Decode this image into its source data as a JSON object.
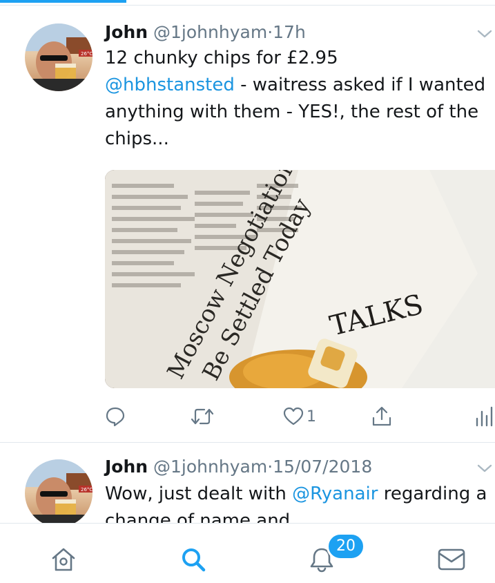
{
  "tweets": [
    {
      "name": "John",
      "handle": "@1johnhyam",
      "separator": "·",
      "time": "17h",
      "text_parts": {
        "line1": "12 chunky chips for £2.95",
        "mention": "@hbhstansted",
        "rest": " - waitress asked if I wanted anything with them - YES!, the rest of the chips..."
      },
      "media": {
        "headline_1": "Moscow Negotiation",
        "headline_2": "Be Settled Today",
        "headline_3": "TALKS"
      },
      "actions": {
        "like_count": "1"
      }
    },
    {
      "name": "John",
      "handle": "@1johnhyam",
      "separator": "·",
      "time": "15/07/2018",
      "text_parts": {
        "lead": "Wow, just dealt with ",
        "mention": "@Ryanair",
        "rest": " regarding a change of name and"
      }
    }
  ],
  "bottom_nav": {
    "items": [
      "home-icon",
      "search-icon",
      "notifications-icon",
      "messages-icon"
    ],
    "notifications_badge": "20",
    "active": "search"
  },
  "colors": {
    "accent": "#1da1f2",
    "mention": "#1b95e0",
    "secondary_text": "#657786",
    "divider": "#e1e8ed"
  }
}
